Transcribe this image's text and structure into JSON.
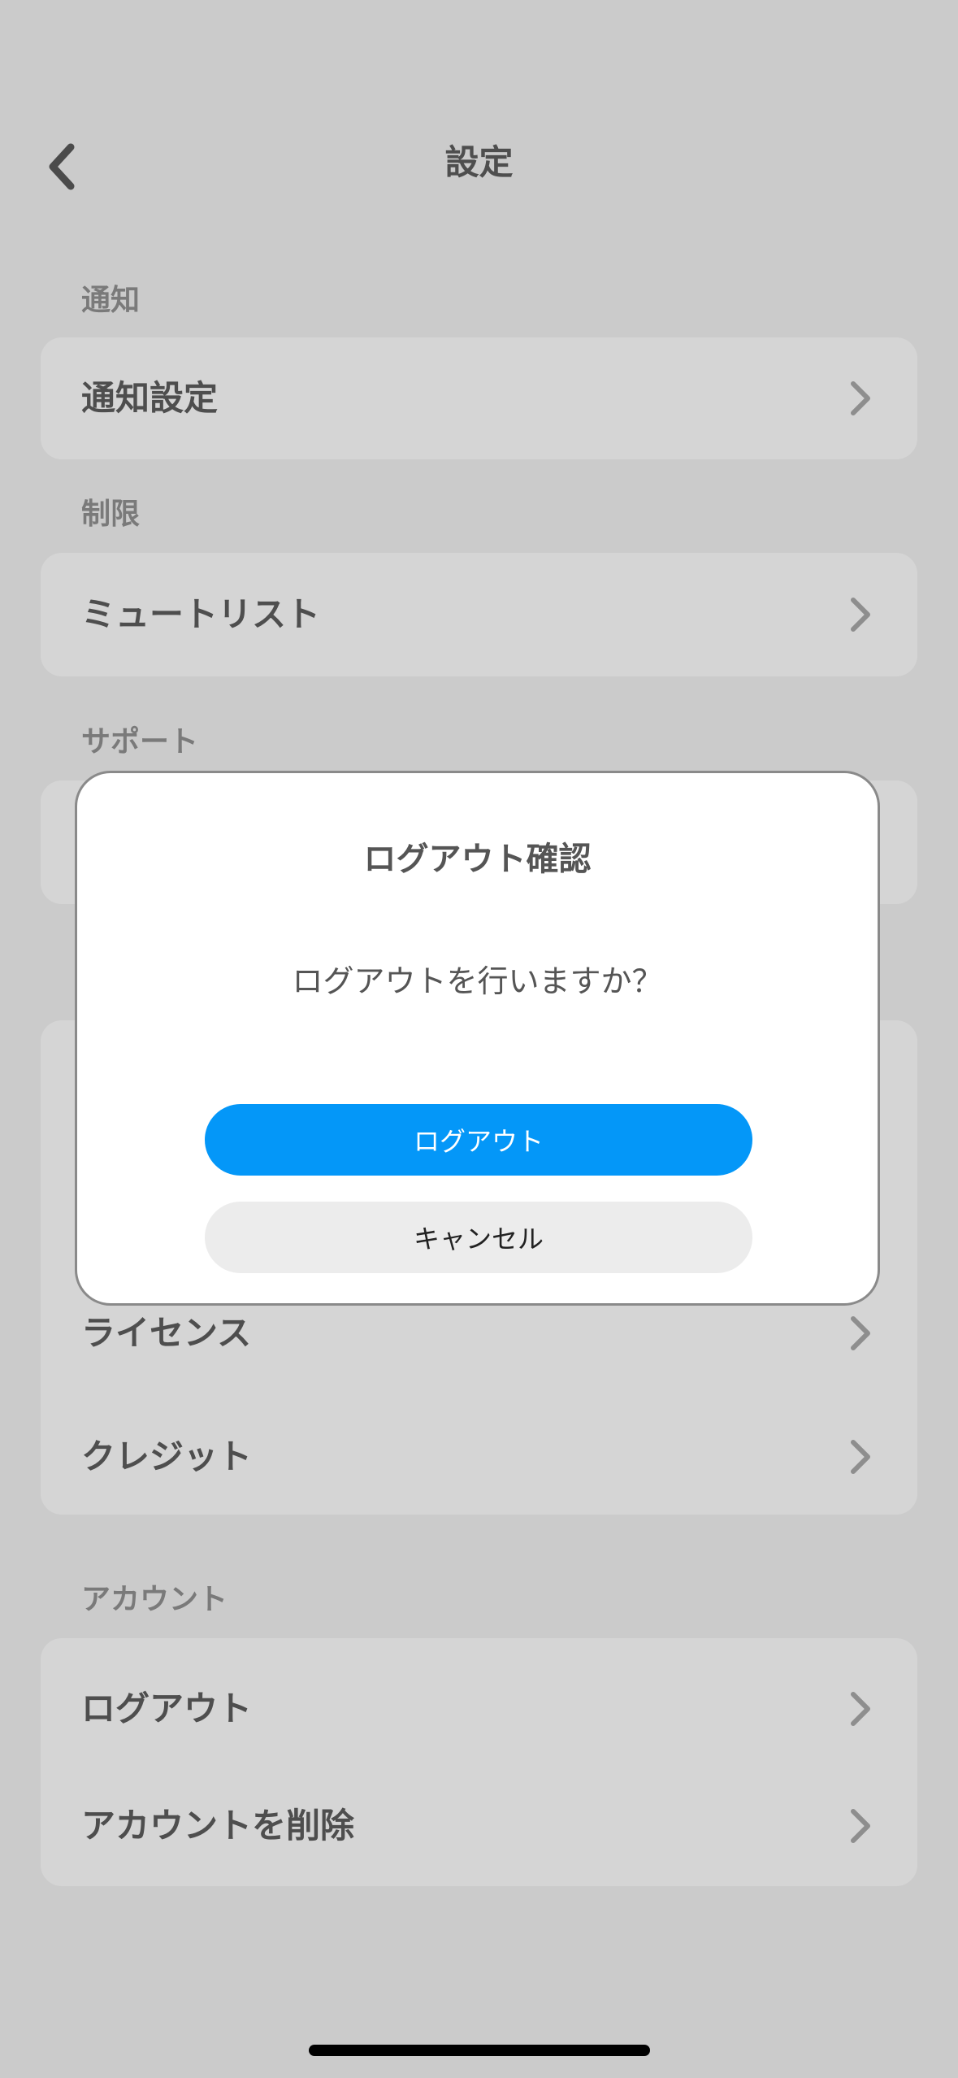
{
  "header": {
    "title": "設定"
  },
  "sections": {
    "notifications": {
      "label": "通知",
      "items": [
        "通知設定"
      ]
    },
    "restrictions": {
      "label": "制限",
      "items": [
        "ミュートリスト"
      ]
    },
    "support": {
      "label": "サポート"
    },
    "info": {
      "items": [
        "ライセンス",
        "クレジット"
      ]
    },
    "account": {
      "label": "アカウント",
      "items": [
        "ログアウト",
        "アカウントを削除"
      ]
    }
  },
  "dialog": {
    "title": "ログアウト確認",
    "message": "ログアウトを行いますか？",
    "confirm_label": "ログアウト",
    "cancel_label": "キャンセル"
  },
  "colors": {
    "background": "#cbcbcb",
    "card": "#d5d5d5",
    "primary": "#0497f8",
    "secondary_button": "#ececec"
  }
}
